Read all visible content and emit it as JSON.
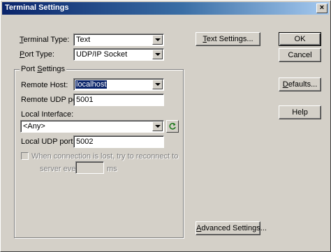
{
  "window": {
    "title": "Terminal Settings",
    "close_glyph": "×"
  },
  "form": {
    "terminal_type": {
      "label_u": "T",
      "label_rest": "erminal Type:",
      "value": "Text"
    },
    "port_type": {
      "label_u": "P",
      "label_rest": "ort Type:",
      "value": "UDP/IP Socket"
    },
    "port_settings": {
      "legend_pre": "Port ",
      "legend_u": "S",
      "legend_rest": "ettings",
      "remote_host": {
        "label": "Remote Host:",
        "value": "localhost"
      },
      "remote_udp_port": {
        "label": "Remote UDP port:",
        "value": "5001"
      },
      "local_interface": {
        "label": "Local Interface:",
        "value": "<Any>"
      },
      "local_udp_port": {
        "label": "Local UDP port:",
        "value": "5002"
      },
      "reconnect": {
        "line1": "When connection is lost, try to reconnect to",
        "line2_pre": "server every",
        "interval_value": "",
        "unit": "ms",
        "checked": false
      }
    }
  },
  "buttons": {
    "text_settings": {
      "label_u": "T",
      "label_rest": "ext Settings..."
    },
    "advanced_settings": {
      "label_u": "A",
      "label_rest": "dvanced Settings..."
    },
    "ok": "OK",
    "cancel": "Cancel",
    "defaults": {
      "label_u": "D",
      "label_rest": "efaults..."
    },
    "help": "Help"
  },
  "icons": {
    "refresh": "refresh-icon",
    "dropdown": "chevron-down-icon",
    "close": "close-icon"
  },
  "colors": {
    "titlebar_start": "#0a246a",
    "titlebar_end": "#a6caf0",
    "selection": "#0a246a",
    "face": "#d4d0c8"
  }
}
